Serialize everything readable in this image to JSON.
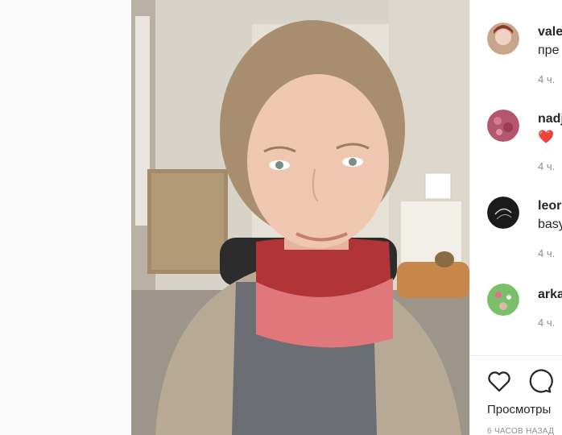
{
  "comments": [
    {
      "username": "vale",
      "text": "пре",
      "time": "4 ч."
    },
    {
      "username": "nadj",
      "text": "❤️",
      "time": "4 ч."
    },
    {
      "username": "leor",
      "text": "basy",
      "time": "4 ч."
    },
    {
      "username": "arka",
      "text": "",
      "time": "4 ч."
    }
  ],
  "actions": {
    "like_icon": "heart-icon",
    "comment_icon": "comment-icon"
  },
  "views_label": "Просмотры",
  "timestamp": "6 ЧАСОВ НАЗАД",
  "colors": {
    "heart": "#ed4956",
    "text": "#262626",
    "muted": "#8e8e8e"
  }
}
